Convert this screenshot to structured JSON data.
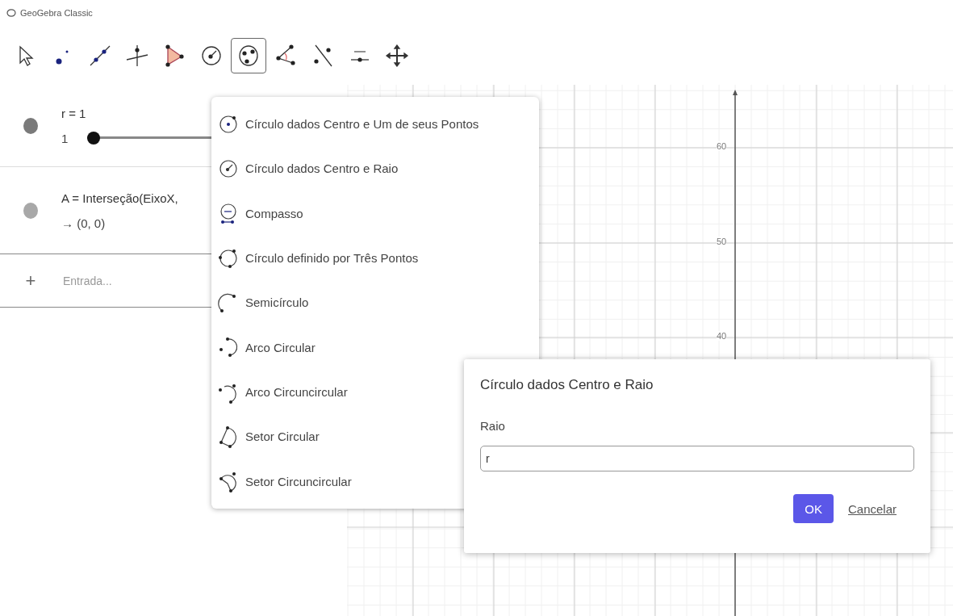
{
  "window": {
    "title": "GeoGebra Classic"
  },
  "toolbar": {
    "tools": [
      {
        "selected": false
      },
      {
        "selected": false
      },
      {
        "selected": false
      },
      {
        "selected": false
      },
      {
        "selected": false
      },
      {
        "selected": false
      },
      {
        "selected": true
      },
      {
        "selected": false
      },
      {
        "selected": false
      },
      {
        "selected": false
      },
      {
        "selected": false
      }
    ]
  },
  "algebra": {
    "rows": [
      {
        "kind": "slider",
        "color": "#7a7a7a",
        "definition": "r = 1",
        "value": "1",
        "level": 0
      },
      {
        "kind": "expression",
        "color": "#a8a8a8",
        "definition": "A = Interseção(EixoX,",
        "value": "→ (0, 0)"
      }
    ],
    "input": {
      "symbol": "+",
      "placeholder": "Entrada..."
    }
  },
  "tool_menu": {
    "items": [
      {
        "label": "Círculo dados Centro e Um de seus Pontos"
      },
      {
        "label": "Círculo dados Centro e Raio"
      },
      {
        "label": "Compasso"
      },
      {
        "label": "Círculo definido por Três Pontos"
      },
      {
        "label": "Semicírculo"
      },
      {
        "label": "Arco Circular"
      },
      {
        "label": "Arco Circuncircular"
      },
      {
        "label": "Setor Circular"
      },
      {
        "label": "Setor Circuncircular"
      }
    ]
  },
  "graphics": {
    "y_axis_labels": [
      "60",
      "50",
      "40"
    ]
  },
  "dialog": {
    "title": "Círculo dados Centro e Raio",
    "field_label": "Raio",
    "value": "r",
    "ok": "OK",
    "cancel": "Cancelar"
  }
}
